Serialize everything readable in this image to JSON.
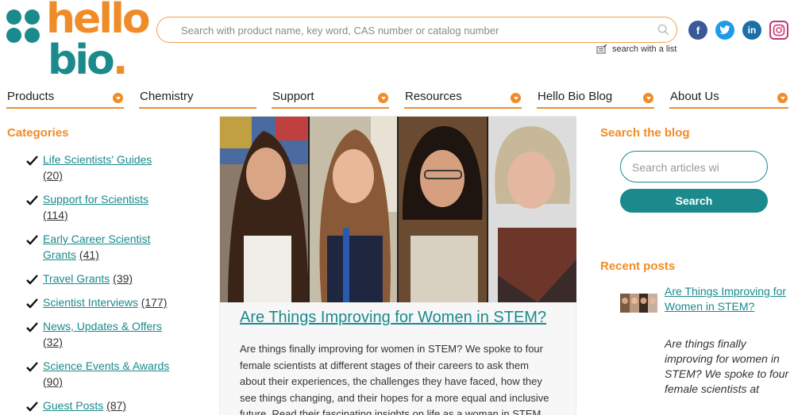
{
  "brand": {
    "logo_word_1": "hello",
    "logo_word_2": "bio",
    "logo_period": ".",
    "primary_color": "#1a8a8c",
    "accent_color": "#f08c28"
  },
  "header": {
    "search_placeholder": "Search with product name, key word, CAS number or catalog number",
    "search_with_list": "search with a list",
    "socials": [
      {
        "name": "facebook",
        "glyph": "f"
      },
      {
        "name": "twitter",
        "glyph": "t"
      },
      {
        "name": "linkedin",
        "glyph": "in"
      },
      {
        "name": "instagram",
        "glyph": ""
      }
    ]
  },
  "nav": {
    "items": [
      {
        "label": "Products",
        "has_dropdown": true
      },
      {
        "label": "Chemistry",
        "has_dropdown": false
      },
      {
        "label": "Support",
        "has_dropdown": true
      },
      {
        "label": "Resources",
        "has_dropdown": true
      },
      {
        "label": "Hello Bio Blog",
        "has_dropdown": true
      },
      {
        "label": "About Us",
        "has_dropdown": true
      }
    ]
  },
  "categories": {
    "title": "Categories",
    "items": [
      {
        "label": "Life Scientists' Guides",
        "count": "(20)"
      },
      {
        "label": "Support for Scientists",
        "count": "(114)"
      },
      {
        "label": "Early Career Scientist Grants",
        "count": "(41)"
      },
      {
        "label": "Travel Grants",
        "count": "(39)"
      },
      {
        "label": "Scientist Interviews",
        "count": "(177)"
      },
      {
        "label": "News, Updates & Offers",
        "count": "(32)"
      },
      {
        "label": "Science Events & Awards",
        "count": "(90)"
      },
      {
        "label": "Guest Posts",
        "count": "(87)"
      }
    ]
  },
  "article": {
    "title": "Are Things Improving for Women in STEM?",
    "excerpt": "Are things finally improving for women in STEM? We spoke to four female scientists at different stages of their careers to ask them about their experiences, the challenges they have faced, how they see things changing, and their hopes for a more equal and inclusive future. Read their fascinating insights on life as a woman in STEM"
  },
  "blog_search": {
    "title": "Search the blog",
    "placeholder": "Search articles wi",
    "button_label": "Search"
  },
  "recent_posts": {
    "title": "Recent posts",
    "items": [
      {
        "title": "Are Things Improving for Women in STEM?",
        "excerpt": "Are things finally improving for women in STEM? We spoke to four female scientists at"
      }
    ]
  }
}
